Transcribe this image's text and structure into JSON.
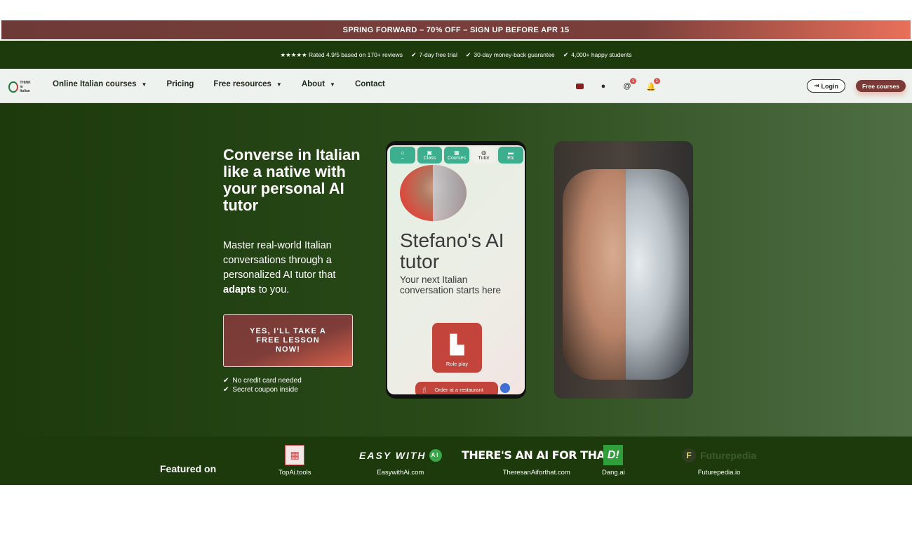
{
  "promo": {
    "text": "SPRING FORWARD – 70% OFF – SIGN UP BEFORE APR 15"
  },
  "trust": {
    "rating": "★★★★★ Rated 4.9/5 based on 170+ reviews",
    "trial": "7-day free trial",
    "guarantee": "30-day money-back guarantee",
    "students": "4,000+ happy students"
  },
  "logo": {
    "line1": "THINK",
    "line2": "in Italian"
  },
  "nav": {
    "items": [
      {
        "label": "Online Italian courses",
        "dropdown": true
      },
      {
        "label": "Pricing",
        "dropdown": false
      },
      {
        "label": "Free resources",
        "dropdown": true
      },
      {
        "label": "About",
        "dropdown": true
      },
      {
        "label": "Contact",
        "dropdown": false
      }
    ],
    "socials": [
      {
        "icon": "youtube-icon"
      },
      {
        "icon": "reddit-icon"
      },
      {
        "icon": "threads-icon",
        "badge": "1"
      },
      {
        "icon": "bell-icon",
        "badge": "1"
      }
    ],
    "login_label": "Login",
    "free_courses_label": "Free courses"
  },
  "hero": {
    "headline": "Converse in Italian like a native with your personal AI tutor",
    "sub_part1": "Master real-world Italian conversations through a personalized AI tutor that ",
    "sub_bold": "adapts",
    "sub_part2": " to you.",
    "cta_label": "YES, I'LL TAKE A FREE LESSON NOW!",
    "checks": [
      "No credit card needed",
      "Secret coupon inside"
    ]
  },
  "phone": {
    "tabs": [
      {
        "icon": "home-icon",
        "label": "–"
      },
      {
        "icon": "class-icon",
        "label": "Class"
      },
      {
        "icon": "courses-icon",
        "label": "Courses"
      },
      {
        "icon": "tutor-icon",
        "label": "Tutor"
      },
      {
        "icon": "folder-icon",
        "label": "Etc"
      }
    ],
    "title": "Stefano's AI tutor",
    "subtitle": "Your next Italian conversation starts here",
    "roleplay_label": "Role play",
    "order_label": "Order at a restaurant"
  },
  "featured": {
    "title": "Featured on",
    "brands": [
      {
        "mark": "▦",
        "name": "TopAi.tools"
      },
      {
        "mark": "EASY WITH",
        "badge": "AI",
        "name": "EasywithAi.com"
      },
      {
        "mark": "THERE'S AN AI FOR THAT",
        "name": "TheresanAiforthat.com"
      },
      {
        "mark": "D!",
        "name": "Dang.ai"
      },
      {
        "mark": "Futurepedia",
        "badge": "F",
        "name": "Futurepedia.io"
      }
    ]
  },
  "colors": {
    "dark_green": "#1c3a0c",
    "brand_red": "#7a3a35",
    "accent": "#e9705a",
    "teal": "#3dae8e"
  }
}
